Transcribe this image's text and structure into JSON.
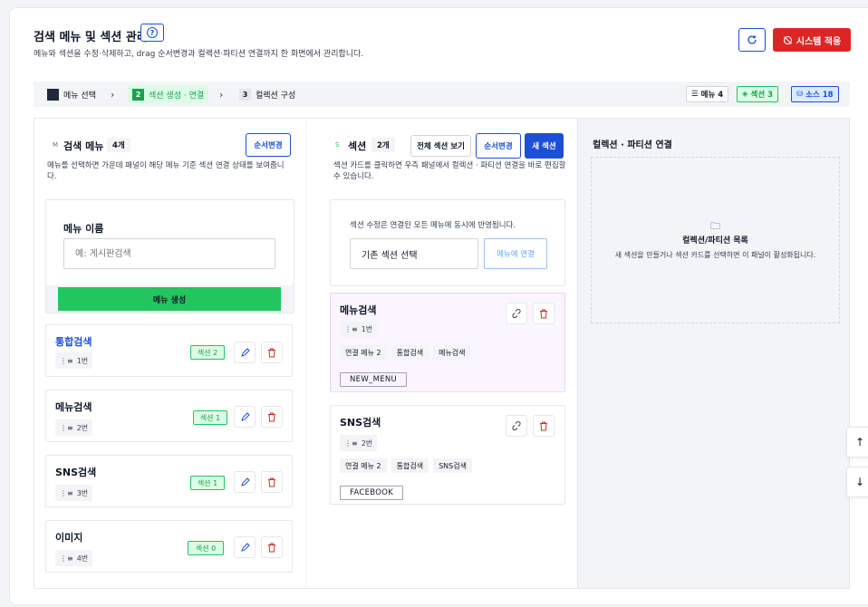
{
  "header": {
    "title": "검색 메뉴 및 섹션 관리",
    "subtitle": "메뉴와 섹션을 수정·삭제하고, drag 순서변경과 컬렉션·파티션 연결까지 한 화면에서 관리합니다.",
    "apply_label": "시스템 적용"
  },
  "steps": [
    {
      "num": "1",
      "label": "메뉴 선택"
    },
    {
      "num": "2",
      "label": "섹션 생성 · 연결"
    },
    {
      "num": "3",
      "label": "컬렉션 구성"
    }
  ],
  "counters": {
    "menu": "메뉴 4",
    "section": "섹션 3",
    "source": "소스 18"
  },
  "menu_panel": {
    "marker": "M",
    "title": "검색 메뉴",
    "count": "4개",
    "reorder_label": "순서변경",
    "desc": "메뉴를 선택하면 가운데 패널이 해당 메뉴 기준 섹션 연결 상태를 보여줍니다.",
    "form_label": "메뉴 이름",
    "input_placeholder": "예: 게시판검색",
    "create_label": "메뉴 생성",
    "items": [
      {
        "name": "통합검색",
        "order": "1번",
        "sections": "섹션 2"
      },
      {
        "name": "메뉴검색",
        "order": "2번",
        "sections": "섹션 1"
      },
      {
        "name": "SNS검색",
        "order": "3번",
        "sections": "섹션 1"
      },
      {
        "name": "이미지",
        "order": "4번",
        "sections": "섹션 0"
      }
    ]
  },
  "section_panel": {
    "marker": "S",
    "title": "섹션",
    "count": "2개",
    "view_all_label": "전체 섹션 보기",
    "reorder_label": "순서변경",
    "new_label": "새 섹션",
    "desc": "섹션 카드를 클릭하면 우측 패널에서 컬렉션 · 파티션 연결을 바로 편집할 수 있습니다.",
    "info_text": "섹션 수정은 연결된 모든 메뉴에 동시에 반영됩니다.",
    "select_placeholder": "기존 섹션 선택",
    "connect_label": "메뉴에 연결",
    "items": [
      {
        "name": "메뉴검색",
        "order": "1번",
        "tags": [
          "연결 메뉴 2",
          "통합검색",
          "메뉴검색"
        ],
        "code": "NEW_MENU"
      },
      {
        "name": "SNS검색",
        "order": "2번",
        "tags": [
          "연결 메뉴 2",
          "통합검색",
          "SNS검색"
        ],
        "code": "FACEBOOK"
      }
    ]
  },
  "collection_panel": {
    "title": "컬렉션 · 파티션 연결",
    "empty_title": "컬렉션/파티션 목록",
    "empty_desc": "새 섹션을 만들거나 섹션 카드를 선택하면 이 패널이 활성화됩니다."
  },
  "colors": {
    "accent": "#1d4ed8",
    "danger": "#dc2626",
    "success": "#22c55e"
  }
}
